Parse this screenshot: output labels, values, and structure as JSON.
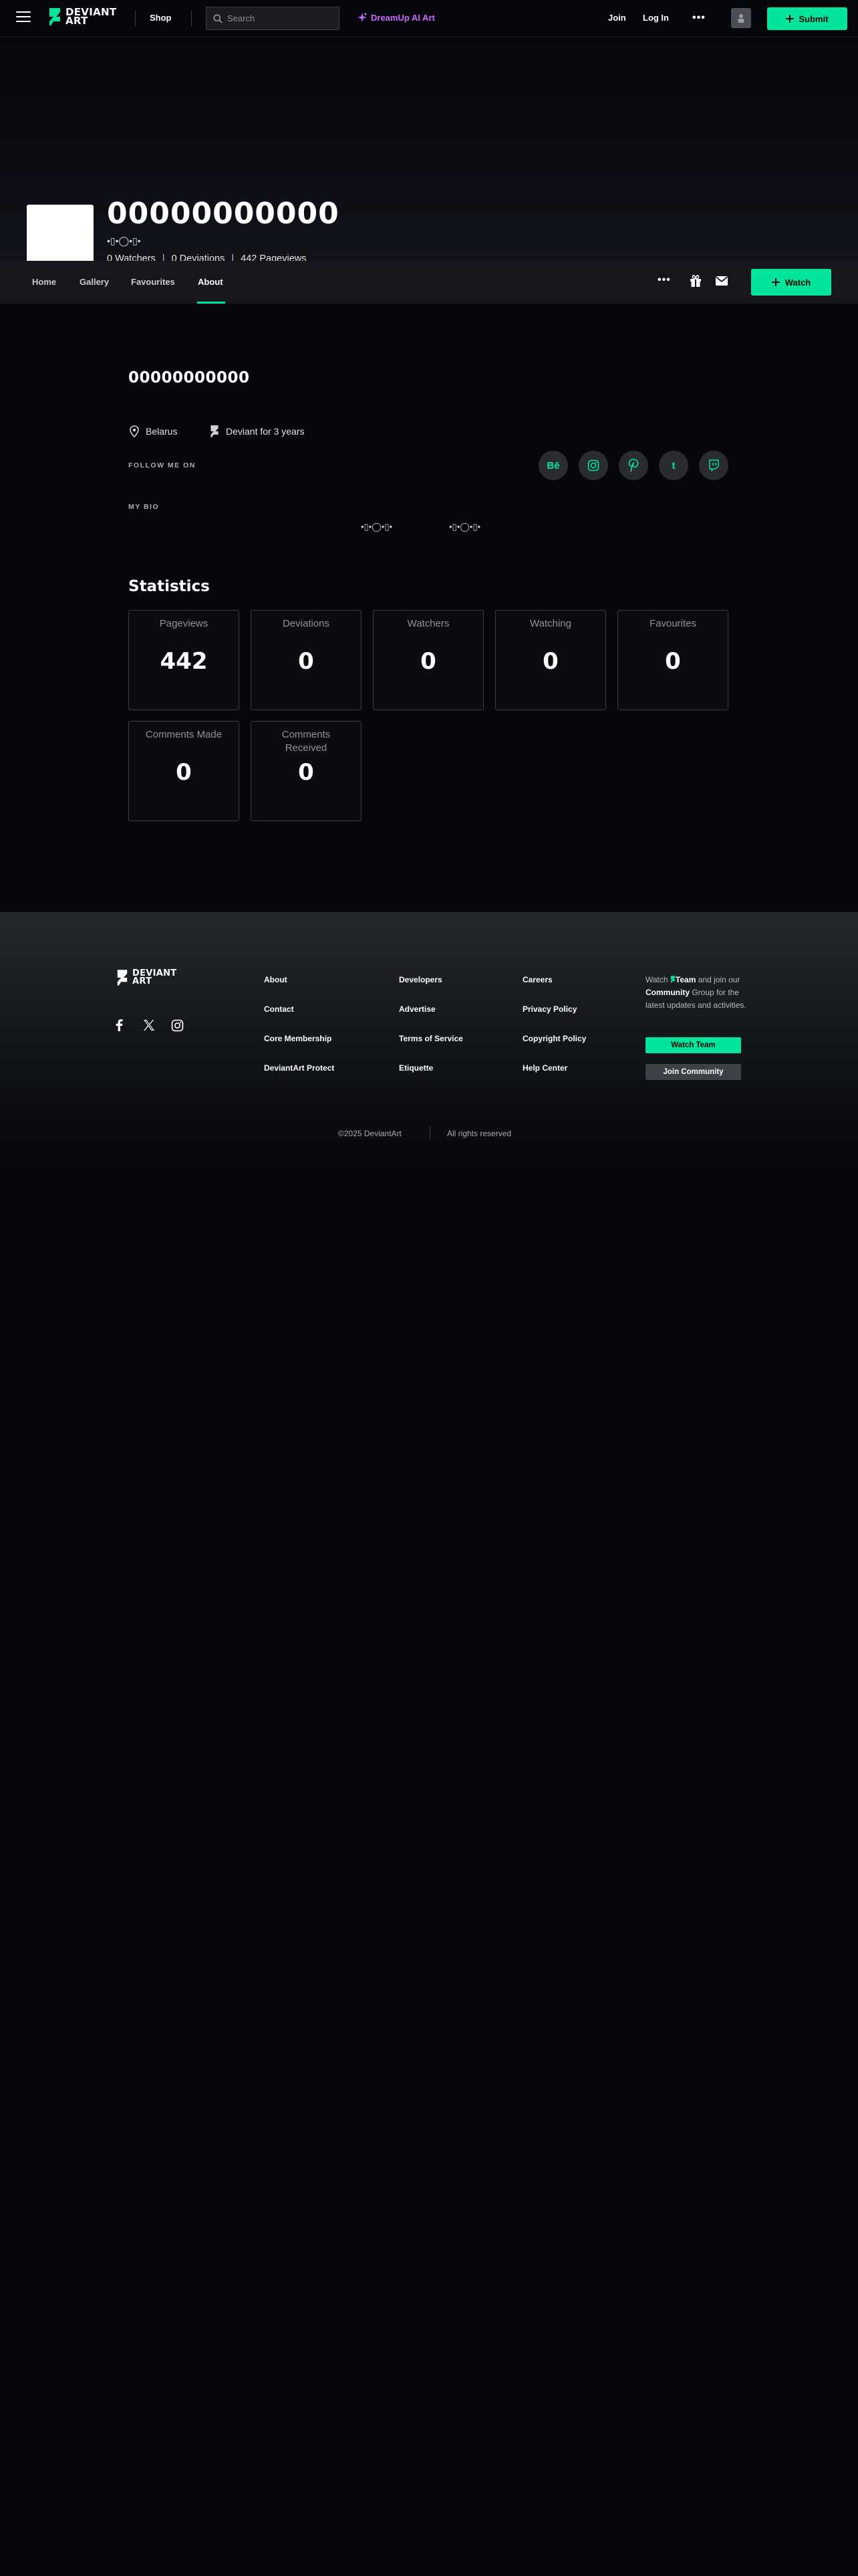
{
  "topbar": {
    "logo_line1": "DEVIANT",
    "logo_line2": "ART",
    "shop_label": "Shop",
    "search_placeholder": "Search",
    "dreamup_label": "DreamUp AI Art",
    "join_label": "Join",
    "login_label": "Log In",
    "more_label": "•••",
    "submit_label": "Submit"
  },
  "profile": {
    "username": "00000000000",
    "tagline": "•▯•◯•▯•",
    "watchers": "0 Watchers",
    "deviations": "0 Deviations",
    "pageviews": "442 Pageviews",
    "separator": "|"
  },
  "profile_nav": {
    "tabs": [
      {
        "label": "Home"
      },
      {
        "label": "Gallery"
      },
      {
        "label": "Favourites"
      },
      {
        "label": "About"
      }
    ],
    "more_label": "•••",
    "watch_label": "Watch"
  },
  "about": {
    "name": "00000000000",
    "location": "Belarus",
    "member_since": "Deviant for 3 years",
    "follow_label": "FOLLOW ME ON",
    "socials": [
      {
        "label": "Bē",
        "icon": "behance-icon"
      },
      {
        "label": "",
        "icon": "instagram-icon"
      },
      {
        "label": "",
        "icon": "pinterest-icon"
      },
      {
        "label": "t",
        "icon": "tumblr-icon"
      },
      {
        "label": "",
        "icon": "twitch-icon"
      }
    ],
    "bio_label": "MY BIO",
    "bio_left": "•▯•◯•▯•",
    "bio_right": "•▯•◯•▯•"
  },
  "statistics": {
    "title": "Statistics",
    "cards": [
      {
        "label": "Pageviews",
        "value": "442"
      },
      {
        "label": "Deviations",
        "value": "0"
      },
      {
        "label": "Watchers",
        "value": "0"
      },
      {
        "label": "Watching",
        "value": "0"
      },
      {
        "label": "Favourites",
        "value": "0"
      },
      {
        "label": "Comments Made",
        "value": "0"
      },
      {
        "label": "Comments Received",
        "value": "0"
      }
    ]
  },
  "footer": {
    "logo_line1": "DEVIANT",
    "logo_line2": "ART",
    "links": [
      [
        "About",
        "Contact",
        "Core Membership",
        "DeviantArt Protect"
      ],
      [
        "Developers",
        "Advertise",
        "Terms of Service",
        "Etiquette"
      ],
      [
        "Careers",
        "Privacy Policy",
        "Copyright Policy",
        "Help Center"
      ]
    ],
    "watch_text_1": "Watch",
    "watch_team": "Team",
    "watch_text_2": "and join our",
    "watch_community": "Community",
    "watch_text_3": "Group for the latest updates and activities.",
    "watch_team_button": "Watch Team",
    "join_community_button": "Join Community",
    "copyright": "©2025 DeviantArt",
    "rights": "All rights reserved"
  },
  "colors": {
    "accent": "#00e59b",
    "dreamup": "#c36bff",
    "background": "#06070d"
  }
}
